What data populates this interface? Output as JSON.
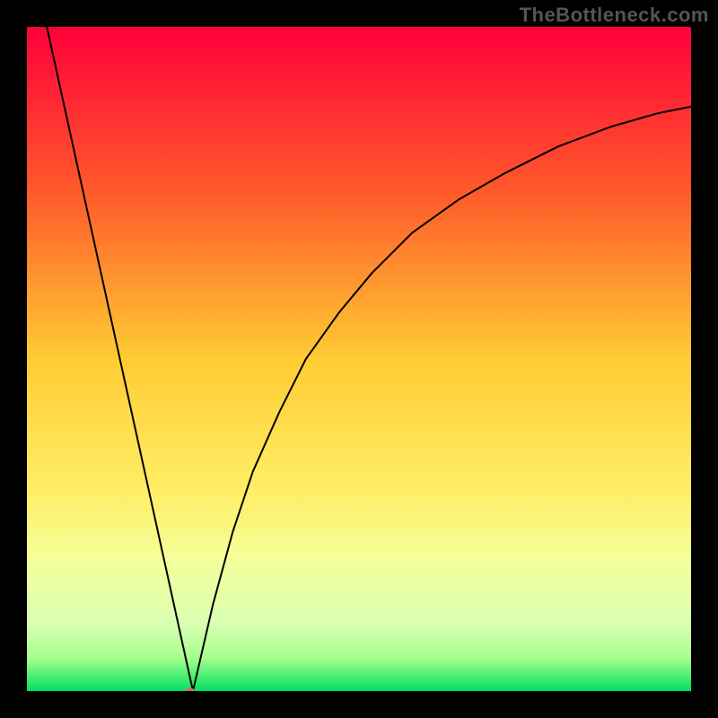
{
  "watermark": "TheBottleneck.com",
  "chart_data": {
    "type": "line",
    "title": "",
    "xlabel": "",
    "ylabel": "",
    "xlim": [
      0,
      100
    ],
    "ylim": [
      0,
      100
    ],
    "grid": false,
    "legend": false,
    "gradient_stops": [
      {
        "offset": 0,
        "color": "#ff003b"
      },
      {
        "offset": 25,
        "color": "#ff5a2a"
      },
      {
        "offset": 50,
        "color": "#ffcc33"
      },
      {
        "offset": 70,
        "color": "#ffee66"
      },
      {
        "offset": 80,
        "color": "#f5ff99"
      },
      {
        "offset": 90,
        "color": "#d9ffb3"
      },
      {
        "offset": 95,
        "color": "#a6ff8c"
      },
      {
        "offset": 100,
        "color": "#00e060"
      }
    ],
    "annotations": [
      {
        "kind": "marker",
        "x": 24.5,
        "y": 0,
        "color": "#c97070",
        "rx": 6,
        "ry": 3.5
      }
    ],
    "series": [
      {
        "name": "left-branch",
        "color": "#000000",
        "x": [
          3,
          25
        ],
        "y": [
          100,
          0
        ]
      },
      {
        "name": "right-branch",
        "color": "#000000",
        "x": [
          25,
          28,
          31,
          34,
          38,
          42,
          47,
          52,
          58,
          65,
          72,
          80,
          88,
          95,
          100
        ],
        "y": [
          0,
          13,
          24,
          33,
          42,
          50,
          57,
          63,
          69,
          74,
          78,
          82,
          85,
          87,
          88
        ]
      }
    ]
  }
}
